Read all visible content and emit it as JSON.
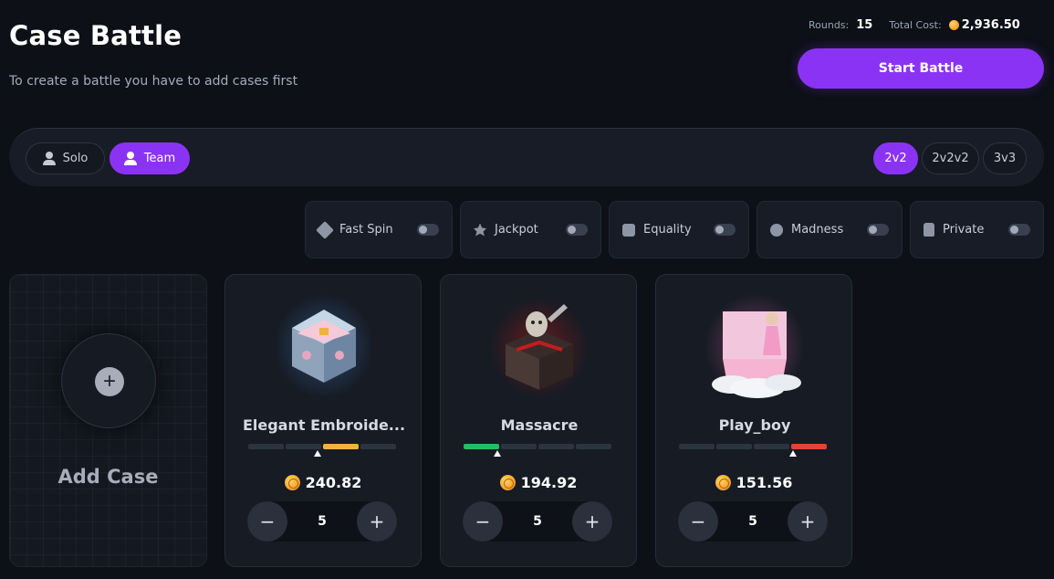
{
  "header": {
    "title": "Case Battle",
    "subtitle": "To create a battle you have to add cases first"
  },
  "summary": {
    "rounds_label": "Rounds:",
    "rounds_value": "15",
    "cost_label": "Total Cost:",
    "cost_value": "2,936.50"
  },
  "start_button": "Start Battle",
  "modes": {
    "solo": "Solo",
    "team": "Team",
    "selected": "Team"
  },
  "team_sizes": {
    "items": [
      "2v2",
      "2v2v2",
      "3v3"
    ],
    "selected": "2v2"
  },
  "options": [
    {
      "label": "Fast Spin",
      "icon": "fast-spin-icon",
      "enabled": false
    },
    {
      "label": "Jackpot",
      "icon": "jackpot-icon",
      "enabled": false
    },
    {
      "label": "Equality",
      "icon": "equality-icon",
      "enabled": false
    },
    {
      "label": "Madness",
      "icon": "madness-icon",
      "enabled": false
    },
    {
      "label": "Private",
      "icon": "lock-icon",
      "enabled": false
    }
  ],
  "add_case": {
    "label": "Add Case",
    "icon": "plus-icon"
  },
  "cases": [
    {
      "name": "Elegant Embroide...",
      "price": "240.82",
      "quantity": "5",
      "risk_level": 2,
      "risk_color": "#f2b23e"
    },
    {
      "name": "Massacre",
      "price": "194.92",
      "quantity": "5",
      "risk_level": 0,
      "risk_color": "#1fbf63"
    },
    {
      "name": "Play_boy",
      "price": "151.56",
      "quantity": "5",
      "risk_level": 3,
      "risk_color": "#e3423c"
    }
  ],
  "colors": {
    "accent": "#8b33f5",
    "background": "#0d1017",
    "card": "#161b24",
    "coin": "#f4a52b"
  }
}
